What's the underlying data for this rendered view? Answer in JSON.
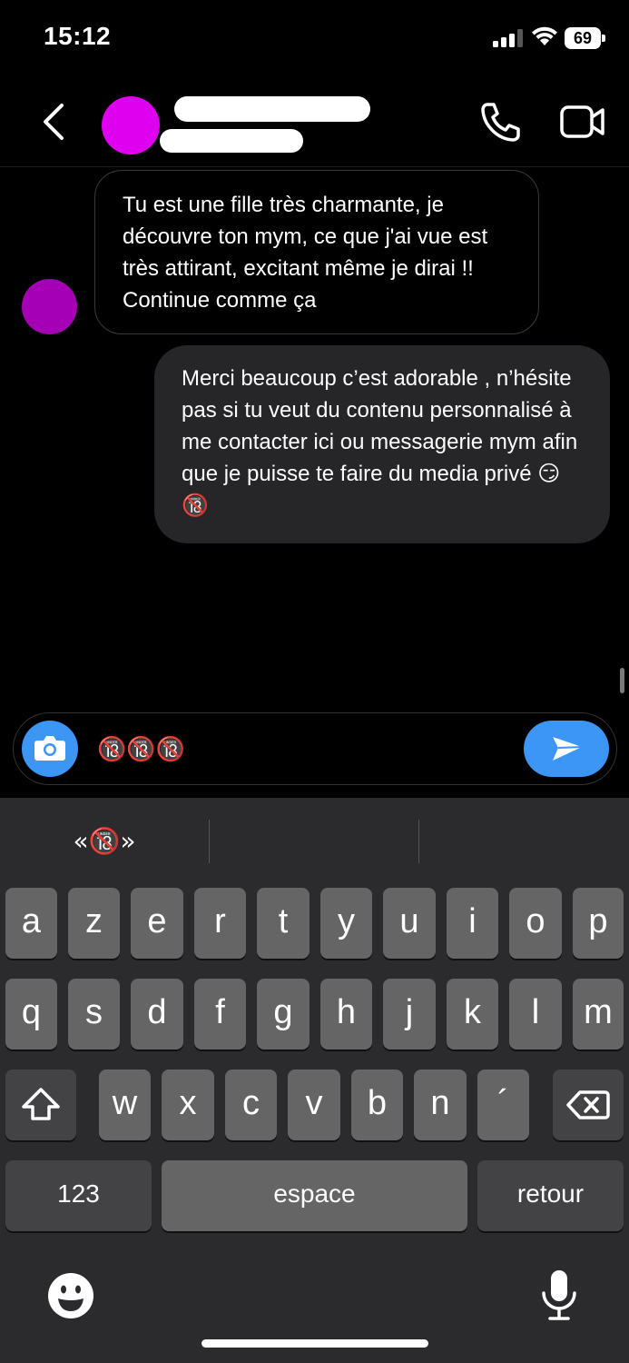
{
  "status_bar": {
    "time": "15:12",
    "battery": "69",
    "signal_icon": "cellular-signal-icon",
    "wifi_icon": "wifi-icon"
  },
  "header": {
    "back_icon": "chevron-left-icon",
    "call_icon": "phone-icon",
    "video_icon": "video-camera-icon",
    "avatar_color": "#e000f0"
  },
  "messages": [
    {
      "direction": "incoming",
      "text": "Tu est une fille très charmante, je découvre ton mym, ce que j'ai vue est très attirant, excitant même je dirai !! Continue comme ça",
      "avatar_color": "#a500b5"
    },
    {
      "direction": "outgoing",
      "text": "Merci beaucoup c’est adorable , n’hésite pas si tu veut du contenu personnalisé à me contacter ici ou messagerie mym afin que je puisse te faire du media privé 😏 🔞"
    }
  ],
  "composer": {
    "value": "🔞🔞🔞",
    "camera_icon": "camera-icon",
    "send_icon": "send-icon",
    "accent": "#3b96f5"
  },
  "keyboard": {
    "suggestions": [
      "«🔞»",
      "",
      ""
    ],
    "row1": [
      "a",
      "z",
      "e",
      "r",
      "t",
      "y",
      "u",
      "i",
      "o",
      "p"
    ],
    "row2": [
      "q",
      "s",
      "d",
      "f",
      "g",
      "h",
      "j",
      "k",
      "l",
      "m"
    ],
    "row3": [
      "w",
      "x",
      "c",
      "v",
      "b",
      "n",
      "´"
    ],
    "numbers_label": "123",
    "space_label": "espace",
    "return_label": "retour",
    "shift_icon": "shift-icon",
    "delete_icon": "delete-icon",
    "emoji_icon": "emoji-icon",
    "mic_icon": "microphone-icon"
  }
}
